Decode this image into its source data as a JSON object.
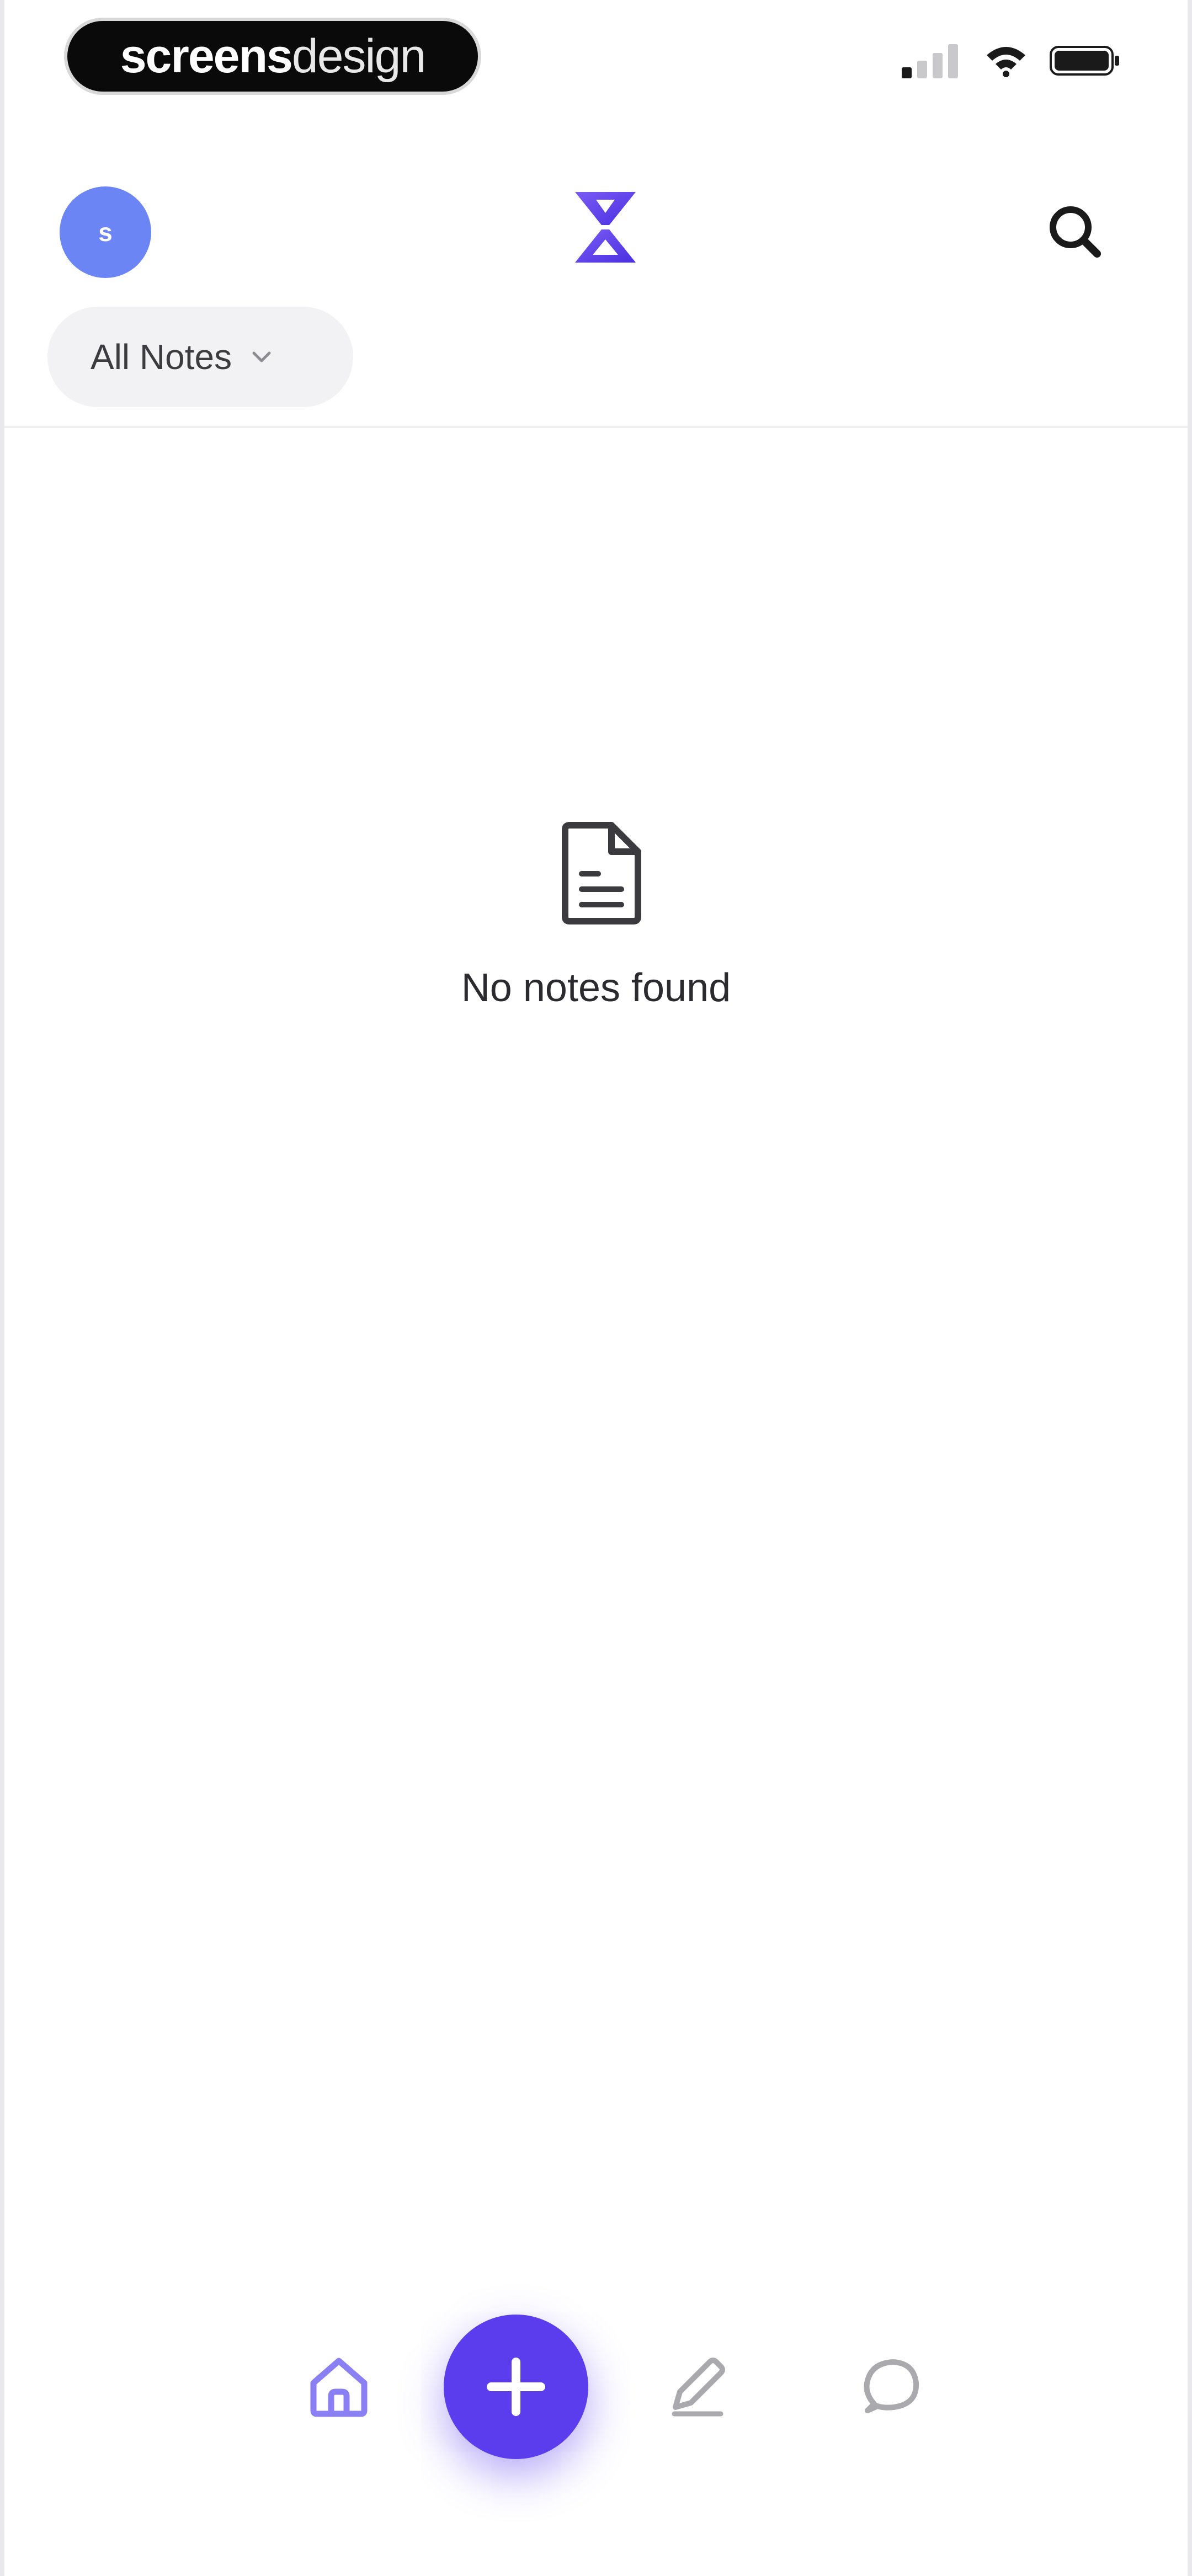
{
  "watermark": {
    "part1": "screens",
    "part2": "design"
  },
  "header": {
    "avatar_initial": "s",
    "filter_label": "All Notes"
  },
  "empty_state": {
    "message": "No notes found"
  },
  "icons": {
    "logo": "hourglass-logo",
    "search": "search-icon",
    "filter_dropdown": "chevron-down-icon",
    "empty": "document-icon",
    "nav_home": "home-icon",
    "nav_add": "plus-icon",
    "nav_edit": "pen-icon",
    "nav_chat": "chat-bubble-icon"
  },
  "colors": {
    "accent": "#5b3ded",
    "avatar": "#6c85f5",
    "nav_active": "#8a7ff3",
    "nav_inactive": "#a9a9ae"
  }
}
